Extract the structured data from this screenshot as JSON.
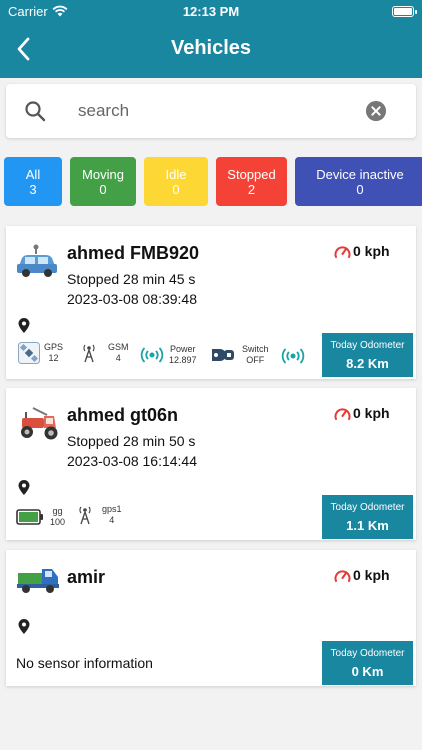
{
  "status_bar": {
    "carrier": "Carrier",
    "time": "12:13 PM"
  },
  "header": {
    "title": "Vehicles",
    "back_icon": "chevron-left-icon"
  },
  "search": {
    "placeholder": "search",
    "value": ""
  },
  "filters": [
    {
      "label": "All",
      "count": "3",
      "color": "#2196f3"
    },
    {
      "label": "Moving",
      "count": "0",
      "color": "#43a047"
    },
    {
      "label": "Idle",
      "count": "0",
      "color": "#fdd835"
    },
    {
      "label": "Stopped",
      "count": "2",
      "color": "#f44336"
    },
    {
      "label": "Device inactive",
      "count": "0",
      "color": "#3f51b5"
    }
  ],
  "vehicles": [
    {
      "name": "ahmed FMB920",
      "icon": "car-icon",
      "speed": "0 kph",
      "status": "Stopped 28 min 45 s",
      "datetime": "2023-03-08 08:39:48",
      "odometer_label": "Today Odometer",
      "odometer": "8.2 Km",
      "sensors": [
        {
          "name": "GPS",
          "value": "12"
        },
        {
          "name": "GSM",
          "value": "4"
        },
        {
          "name": "Power",
          "value": "12.897"
        },
        {
          "name": "Switch",
          "value": "OFF"
        }
      ]
    },
    {
      "name": "ahmed gt06n",
      "icon": "tractor-icon",
      "speed": "0 kph",
      "status": "Stopped 28 min 50 s",
      "datetime": "2023-03-08 16:14:44",
      "odometer_label": "Today Odometer",
      "odometer": "1.1 Km",
      "sensors": [
        {
          "name": "gg",
          "value": "100"
        },
        {
          "name": "gps1",
          "value": "4"
        }
      ]
    },
    {
      "name": "amir",
      "icon": "truck-icon",
      "speed": "0 kph",
      "no_sensor": "No sensor information",
      "odometer_label": "Today Odometer",
      "odometer": "0 Km"
    }
  ],
  "colors": {
    "primary": "#1a87a0",
    "speed_icon": "#e53935"
  }
}
